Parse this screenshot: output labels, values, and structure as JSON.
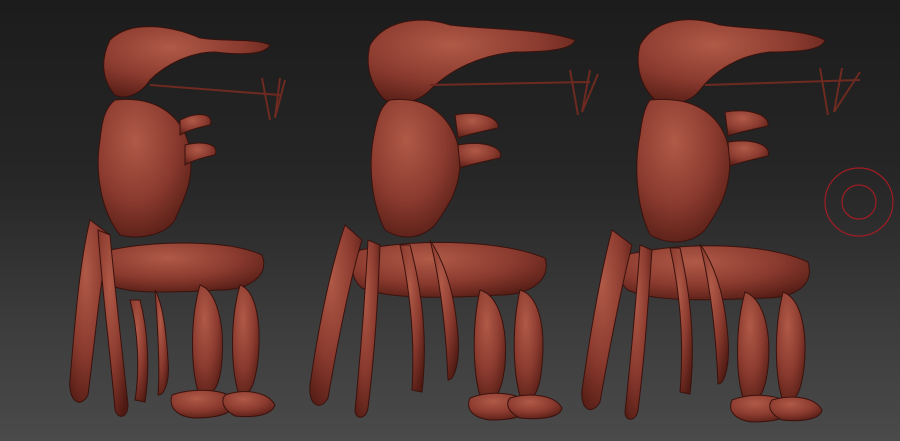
{
  "app": {
    "canvas": {
      "background_top": "#1c1c1c",
      "background_bottom": "#4a4a4a"
    },
    "material_color": "#8a3a2e",
    "material_shadow": "#4f1a13",
    "material_highlight": "#b05a48",
    "figures": [
      {
        "id": "figure-side-view",
        "view": "side"
      },
      {
        "id": "figure-three-quarter-view",
        "view": "three-quarter"
      },
      {
        "id": "figure-front-three-quarter-view",
        "view": "front-three-quarter"
      }
    ],
    "brush_cursor": {
      "icon": "brush-circle-icon",
      "color": "#a11d24"
    }
  }
}
